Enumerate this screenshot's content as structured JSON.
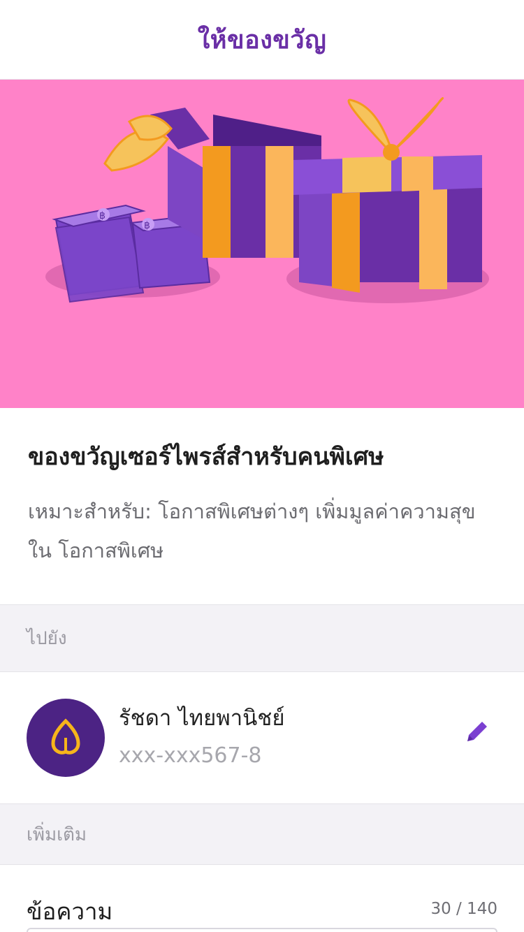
{
  "header": {
    "title": "ให้ของขวัญ"
  },
  "banner": {
    "colors": {
      "background": "#ff82c8",
      "purple": "#6a2fa6",
      "ribbon": "#f6c35b"
    },
    "coin_symbol": "฿"
  },
  "gift": {
    "title": "ของขวัญเซอร์ไพรส์สำหรับคนพิเศษ",
    "description": "เหมาะสำหรับ: โอกาสพิเศษต่างๆ เพิ่มมูลค่าความสุขใน โอกาสพิเศษ"
  },
  "to_section": {
    "label": "ไปยัง"
  },
  "recipient": {
    "name": "รัชดา ไทยพานิชย์",
    "account": "xxx-xxx567-8",
    "icon": "bank-logo-icon"
  },
  "more_section": {
    "label": "เพิ่มเติม"
  },
  "message": {
    "label": "ข้อความ",
    "counter": "30 / 140"
  }
}
